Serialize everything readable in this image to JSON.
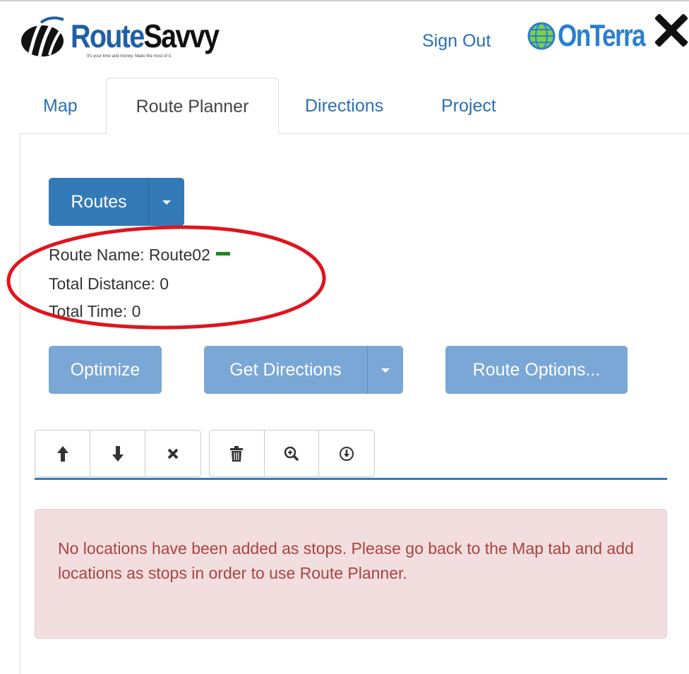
{
  "header": {
    "logo_route": "Route",
    "logo_savvy": "Savvy",
    "logo_tagline": "It's your time and money. Make the most of it.",
    "sign_out_label": "Sign Out",
    "partner_logo": "OnTerra",
    "close_icon": "close-icon"
  },
  "tabs": [
    {
      "label": "Map",
      "active": false
    },
    {
      "label": "Route Planner",
      "active": true
    },
    {
      "label": "Directions",
      "active": false
    },
    {
      "label": "Project",
      "active": false
    }
  ],
  "route_planner": {
    "routes_button_label": "Routes",
    "route_name_label": "Route Name: Route02",
    "route_color": "#1a8a1a",
    "total_distance_label": "Total Distance: 0",
    "total_time_label": "Total Time: 0",
    "optimize_label": "Optimize",
    "get_directions_label": "Get Directions",
    "route_options_label": "Route Options...",
    "annotation_color": "#e0141e",
    "toolbar": {
      "group1": [
        "arrow-up-icon",
        "arrow-down-icon",
        "remove-icon"
      ],
      "group2": [
        "trash-icon",
        "zoom-in-icon",
        "download-icon"
      ]
    },
    "alert_message": "No locations have been added as stops. Please go back to the Map tab and add locations as stops in order to use Route Planner."
  },
  "colors": {
    "primary": "#337ab7",
    "primary_light": "#7aa7d6",
    "alert_bg": "#f2dede",
    "alert_text": "#a94442",
    "link": "#2a6fb5"
  }
}
